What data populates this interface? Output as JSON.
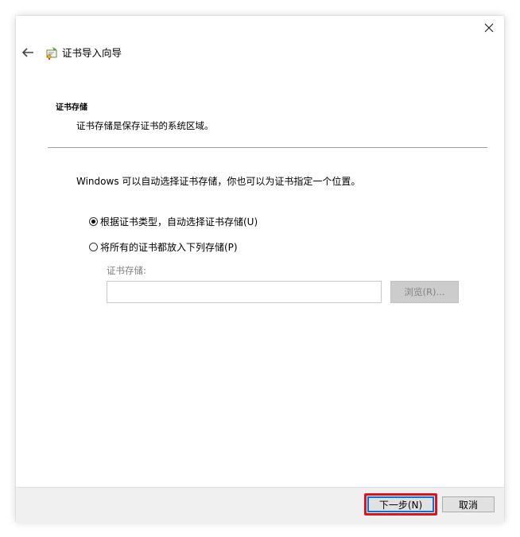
{
  "wizard": {
    "title": "证书导入向导"
  },
  "section": {
    "title": "证书存储",
    "description": "证书存储是保存证书的系统区域。"
  },
  "content": {
    "intro": "Windows 可以自动选择证书存储，你也可以为证书指定一个位置。",
    "option_auto": {
      "label": "根据证书类型，自动选择证书存储(U)",
      "selected": true
    },
    "option_manual": {
      "label": "将所有的证书都放入下列存储(P)",
      "selected": false
    },
    "store_label": "证书存储:",
    "store_value": "",
    "browse_label": "浏览(R)..."
  },
  "footer": {
    "next_label": "下一步(N)",
    "cancel_label": "取消"
  },
  "colors": {
    "highlight": "#d9161c",
    "focus_border": "#0078d7",
    "footer_bg": "#f0f0f0",
    "disabled_text": "#838383"
  },
  "icons": [
    "close-icon",
    "back-arrow-icon",
    "certificate-icon",
    "radio-selected-icon",
    "radio-unselected-icon"
  ]
}
